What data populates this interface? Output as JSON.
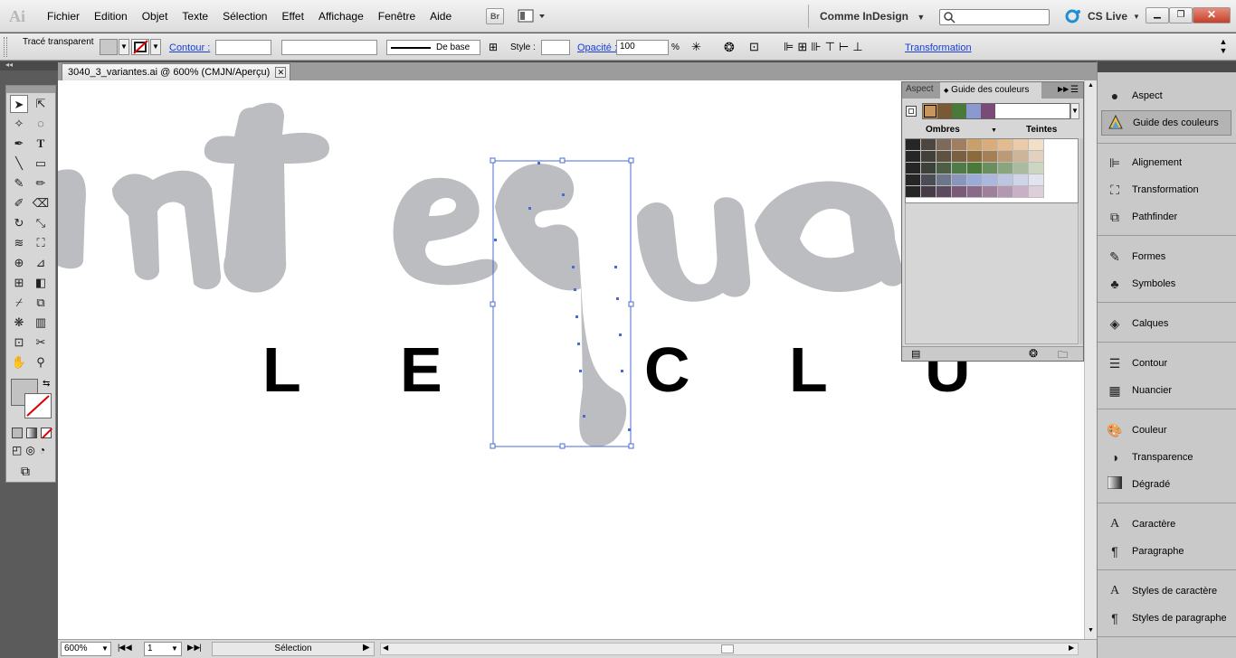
{
  "app": {
    "logo": "Ai"
  },
  "menu": [
    "Fichier",
    "Edition",
    "Objet",
    "Texte",
    "Sélection",
    "Effet",
    "Affichage",
    "Fenêtre",
    "Aide"
  ],
  "menubar": {
    "bridge_label": "Br",
    "workspace": "Comme InDesign",
    "cs_live": "CS Live"
  },
  "control": {
    "selection_label": "Tracé transparent",
    "contour_label": "Contour :",
    "stroke_profile": "De base",
    "style_label": "Style :",
    "opacity_label": "Opacité :",
    "opacity_value": "100",
    "percent": "%",
    "transform_link": "Transformation"
  },
  "document": {
    "tab_title": "3040_3_variantes.ai @ 600% (CMJN/Aperçu)"
  },
  "artwork": {
    "letters": [
      "L",
      "E",
      "C",
      "L",
      "U"
    ]
  },
  "status": {
    "zoom": "600%",
    "page": "1",
    "tool": "Sélection"
  },
  "panel": {
    "tabs": [
      "Aspect",
      "Guide des couleurs"
    ],
    "col_shades": "Ombres",
    "col_tints": "Teintes",
    "harmony": [
      "#c8955a",
      "#7a5a32",
      "#4a7a3a",
      "#8a9ad0",
      "#7a4a78"
    ],
    "swatch_rows": [
      [
        "#262626",
        "#4d4540",
        "#7d6a5a",
        "#9e8060",
        "#c9a06a",
        "#d9ac7a",
        "#e2bb90",
        "#eaccaa",
        "#f2dfc8"
      ],
      [
        "#262626",
        "#43403a",
        "#5f5240",
        "#7a6040",
        "#8e6a38",
        "#a68055",
        "#bb9a75",
        "#cfb598",
        "#e2d1bf"
      ],
      [
        "#262626",
        "#3c4238",
        "#4d5e45",
        "#507a48",
        "#4a7a3a",
        "#6a8e5d",
        "#8aa57e",
        "#aabca0",
        "#cbd6c3"
      ],
      [
        "#262626",
        "#4a4d55",
        "#6d7588",
        "#8896bb",
        "#9aabd9",
        "#aab8dd",
        "#bcc6e2",
        "#ced5e8",
        "#e0e4ee"
      ],
      [
        "#262626",
        "#463c46",
        "#5e4a5e",
        "#7a5a78",
        "#8a6a88",
        "#9e809c",
        "#b497b2",
        "#c9b0c7",
        "#ddcedc"
      ]
    ]
  },
  "dock": [
    {
      "label": "Aspect",
      "icon": "circle-icon"
    },
    {
      "label": "Guide des couleurs",
      "icon": "color-guide-icon"
    },
    {
      "label": "Alignement",
      "icon": "align-icon"
    },
    {
      "label": "Transformation",
      "icon": "transform-icon"
    },
    {
      "label": "Pathfinder",
      "icon": "pathfinder-icon"
    },
    {
      "label": "Formes",
      "icon": "brush-icon"
    },
    {
      "label": "Symboles",
      "icon": "club-icon"
    },
    {
      "label": "Calques",
      "icon": "layers-icon"
    },
    {
      "label": "Contour",
      "icon": "stroke-icon"
    },
    {
      "label": "Nuancier",
      "icon": "swatches-icon"
    },
    {
      "label": "Couleur",
      "icon": "palette-icon"
    },
    {
      "label": "Transparence",
      "icon": "transparency-icon"
    },
    {
      "label": "Dégradé",
      "icon": "gradient-icon"
    },
    {
      "label": "Caractère",
      "icon": "character-icon"
    },
    {
      "label": "Paragraphe",
      "icon": "pilcrow-icon"
    },
    {
      "label": "Styles de caractère",
      "icon": "char-style-icon"
    },
    {
      "label": "Styles de paragraphe",
      "icon": "para-style-icon"
    }
  ]
}
